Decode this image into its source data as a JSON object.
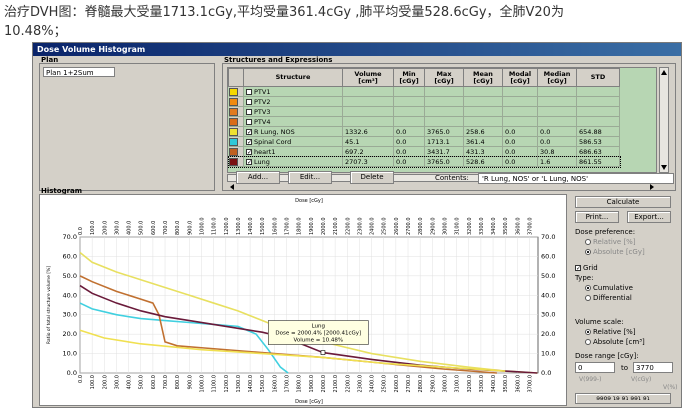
{
  "caption": {
    "line1": "治疗DVH图：脊髓最大受量1713.1cGy,平均受量361.4cGy ,肺平均受量528.6cGy，全肺V20为",
    "line2": "10.48%；"
  },
  "window": {
    "title": "Dose Volume Histogram"
  },
  "plan": {
    "group_label": "Plan",
    "selected": "Plan 1+2Sum"
  },
  "structures": {
    "group_label": "Structures and Expressions",
    "columns": [
      "Structure",
      "Volume [cm³]",
      "Min [cGy]",
      "Max [cGy]",
      "Mean [cGy]",
      "Modal [cGy]",
      "Median [cGy]",
      "STD"
    ],
    "rows": [
      {
        "color": "#f5d800",
        "checked": false,
        "name": "PTV1",
        "volume": "",
        "min": "",
        "max": "",
        "mean": "",
        "modal": "",
        "median": "",
        "std": ""
      },
      {
        "color": "#f08a10",
        "checked": false,
        "name": "PTV2",
        "volume": "",
        "min": "",
        "max": "",
        "mean": "",
        "modal": "",
        "median": "",
        "std": ""
      },
      {
        "color": "#e07a20",
        "checked": false,
        "name": "PTV3",
        "volume": "",
        "min": "",
        "max": "",
        "mean": "",
        "modal": "",
        "median": "",
        "std": ""
      },
      {
        "color": "#d86a18",
        "checked": false,
        "name": "PTV4",
        "volume": "",
        "min": "",
        "max": "",
        "mean": "",
        "modal": "",
        "median": "",
        "std": ""
      },
      {
        "color": "#f0e030",
        "checked": true,
        "name": "R Lung, NOS",
        "volume": "1332.6",
        "min": "0.0",
        "max": "3765.0",
        "mean": "258.6",
        "modal": "0.0",
        "median": "0.0",
        "std": "654.88"
      },
      {
        "color": "#30c8d8",
        "checked": true,
        "name": "Spinal Cord",
        "volume": "45.1",
        "min": "0.0",
        "max": "1713.1",
        "mean": "361.4",
        "modal": "0.0",
        "median": "0.0",
        "std": "586.53"
      },
      {
        "color": "#c06020",
        "checked": true,
        "name": "heart1",
        "volume": "697.2",
        "min": "0.0",
        "max": "3431.7",
        "mean": "431.3",
        "modal": "0.0",
        "median": "30.8",
        "std": "686.63"
      },
      {
        "color": "#7a1010",
        "checked": true,
        "name": "Lung",
        "volume": "2707.3",
        "min": "0.0",
        "max": "3765.0",
        "mean": "528.6",
        "modal": "0.0",
        "median": "1.6",
        "std": "861.55"
      }
    ]
  },
  "buttons": {
    "add": "Add...",
    "edit": "Edit...",
    "delete": "Delete",
    "calculate": "Calculate",
    "print": "Print...",
    "export": "Export..."
  },
  "contents": {
    "label": "Contents:",
    "value": "'R Lung, NOS' or 'L Lung, NOS'"
  },
  "histogram": {
    "group_label": "Histogram",
    "axis_title_top": "Dose [cGy]",
    "axis_title_bottom": "Dose [cGy]",
    "ylabel": "Ratio of total structure volume [%]"
  },
  "tooltip": {
    "name": "Lung",
    "dose": "Dose = 2000.4% [2000.41cGy]",
    "volume": "Volume = 10.48%"
  },
  "options": {
    "dose_pref_label": "Dose preference:",
    "dose_pref_relative": "Relative [%]",
    "dose_pref_absolute": "Absolute [cGy]",
    "grid_label": "Grid",
    "type_label": "Type:",
    "type_cumulative": "Cumulative",
    "type_differential": "Differential",
    "vol_scale_label": "Volume scale:",
    "vol_relative": "Relative [%]",
    "vol_absolute": "Absolute [cm³]",
    "dose_range_label": "Dose range [cGy]:",
    "range_from": "0",
    "range_to_label": "to",
    "range_to": "3770",
    "mirror1": "V(999-)",
    "mirror2": "V(cGy)",
    "mirror3": "V(%)",
    "mirror_btn": "ɘɘoɘ ɿɘ ɘɿ ɘɘɿ ɘɿ"
  },
  "chart_data": {
    "type": "line",
    "xlabel": "Dose [cGy]",
    "ylabel": "Ratio of total structure volume [%]",
    "xlim": [
      0,
      3770
    ],
    "ylim": [
      0,
      70
    ],
    "xticks": [
      0,
      100,
      200,
      300,
      400,
      500,
      600,
      700,
      800,
      900,
      1000,
      1100,
      1200,
      1300,
      1400,
      1500,
      1600,
      1700,
      1800,
      1900,
      2000,
      2100,
      2200,
      2300,
      2400,
      2500,
      2600,
      2700,
      2800,
      2900,
      3000,
      3100,
      3200,
      3300,
      3400,
      3500,
      3600,
      3700
    ],
    "yticks": [
      0,
      10,
      20,
      30,
      40,
      50,
      60,
      70
    ],
    "grid": true,
    "series": [
      {
        "name": "R Lung, NOS",
        "color": "#e8e060",
        "x": [
          0,
          100,
          300,
          500,
          700,
          900,
          1100,
          1300,
          1500,
          1700,
          2000,
          2400,
          2800,
          3200,
          3500,
          3765
        ],
        "y": [
          62,
          57,
          52,
          48,
          44,
          40,
          36,
          32,
          27,
          22,
          16,
          10,
          6,
          3,
          1,
          0
        ]
      },
      {
        "name": "Spinal Cord",
        "color": "#40d0e0",
        "x": [
          0,
          100,
          300,
          500,
          700,
          900,
          1100,
          1300,
          1450,
          1550,
          1650,
          1713
        ],
        "y": [
          36,
          33,
          30,
          28,
          27,
          26,
          25,
          24,
          20,
          12,
          3,
          0
        ]
      },
      {
        "name": "heart1",
        "color": "#c07030",
        "x": [
          0,
          100,
          300,
          500,
          600,
          650,
          700,
          800,
          1000,
          1400,
          2000,
          2500,
          3000,
          3432
        ],
        "y": [
          50,
          47,
          42,
          38,
          36,
          30,
          16,
          14,
          13,
          11,
          8,
          5,
          2,
          0
        ]
      },
      {
        "name": "Lung",
        "color": "#6a1a3a",
        "x": [
          0,
          100,
          300,
          500,
          700,
          900,
          1100,
          1300,
          1500,
          1700,
          2000,
          2400,
          2800,
          3200,
          3500,
          3765
        ],
        "y": [
          45,
          41,
          36,
          32,
          29,
          27,
          25,
          23,
          21,
          18,
          10.5,
          7,
          4,
          2,
          1,
          0
        ]
      },
      {
        "name": "PTV",
        "color": "#f0e050",
        "x": [
          0,
          200,
          500,
          1000,
          1500,
          2000,
          2500,
          3000,
          3500
        ],
        "y": [
          22,
          18,
          15,
          12,
          10,
          8,
          5,
          3,
          1
        ]
      }
    ]
  }
}
